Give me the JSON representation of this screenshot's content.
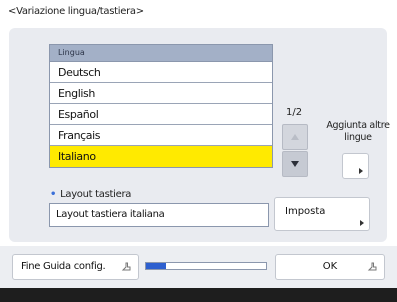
{
  "screen": {
    "title": "<Variazione lingua/tastiera>"
  },
  "language_list": {
    "header": "Lingua",
    "items": [
      "Deutsch",
      "English",
      "Español",
      "Français",
      "Italiano"
    ],
    "selected_index": 4
  },
  "pagination": {
    "indicator": "1/2"
  },
  "add_languages": {
    "label": "Aggiunta altre lingue"
  },
  "keyboard_layout": {
    "label": "Layout tastiera",
    "value": "Layout tastiera italiana",
    "set_button": "Imposta"
  },
  "footer": {
    "end_guide_button": "Fine Guida config.",
    "progress_fraction": 0.17,
    "ok_button": "OK"
  },
  "colors": {
    "selected_row": "#ffea00",
    "progress_fill": "#2d5fcf",
    "header_bg": "#a3b0c7"
  },
  "icons": {
    "scroll_up": "up-arrow-icon",
    "scroll_down": "down-arrow-icon",
    "button_corner": "corner-triangle-icon",
    "hand": "hand-pointer-icon"
  }
}
